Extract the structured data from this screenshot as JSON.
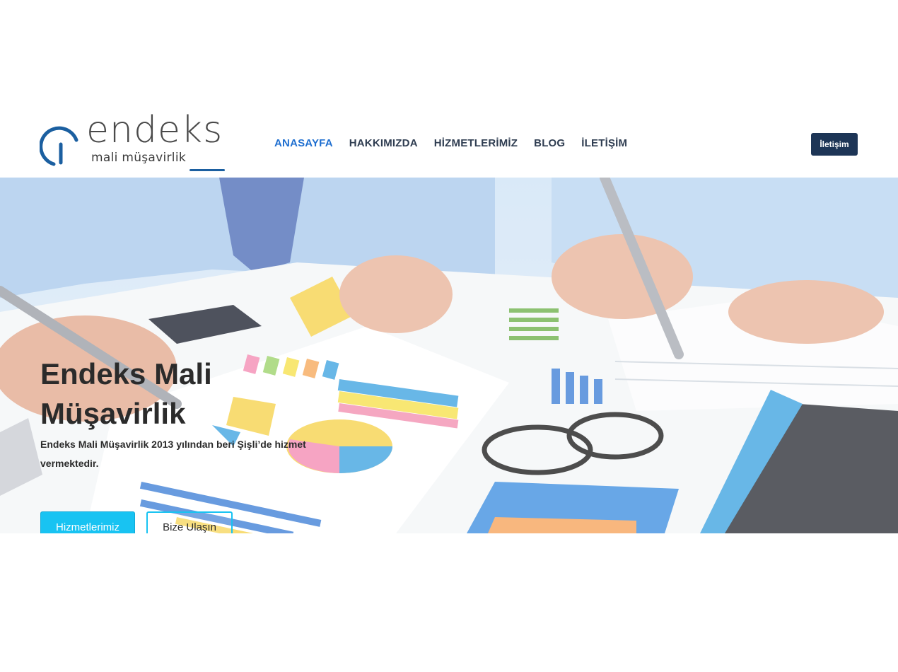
{
  "logo": {
    "word": "endeks",
    "sub": "mali müşavirlik",
    "brand_color": "#1b5fa0"
  },
  "nav": {
    "items": [
      {
        "label": "ANASAYFA",
        "active": true
      },
      {
        "label": "HAKKIMIZDA",
        "active": false
      },
      {
        "label": "HİZMETLERİMİZ",
        "active": false
      },
      {
        "label": "BLOG",
        "active": false
      },
      {
        "label": "İLETİŞİM",
        "active": false
      }
    ],
    "active_color": "#1f6fd0",
    "text_color": "#2f3d51"
  },
  "header_cta": {
    "label": "İletişim",
    "color": "#1d3556"
  },
  "hero": {
    "title": "Endeks Mali Müşavirlik",
    "text": "Endeks Mali Müşavirlik 2013 yılından beri Şişli’de hizmet vermektedir.",
    "primary_button": "Hizmetlerimiz",
    "secondary_button": "Bize Ulaşın",
    "accent_color": "#18c3f2"
  }
}
